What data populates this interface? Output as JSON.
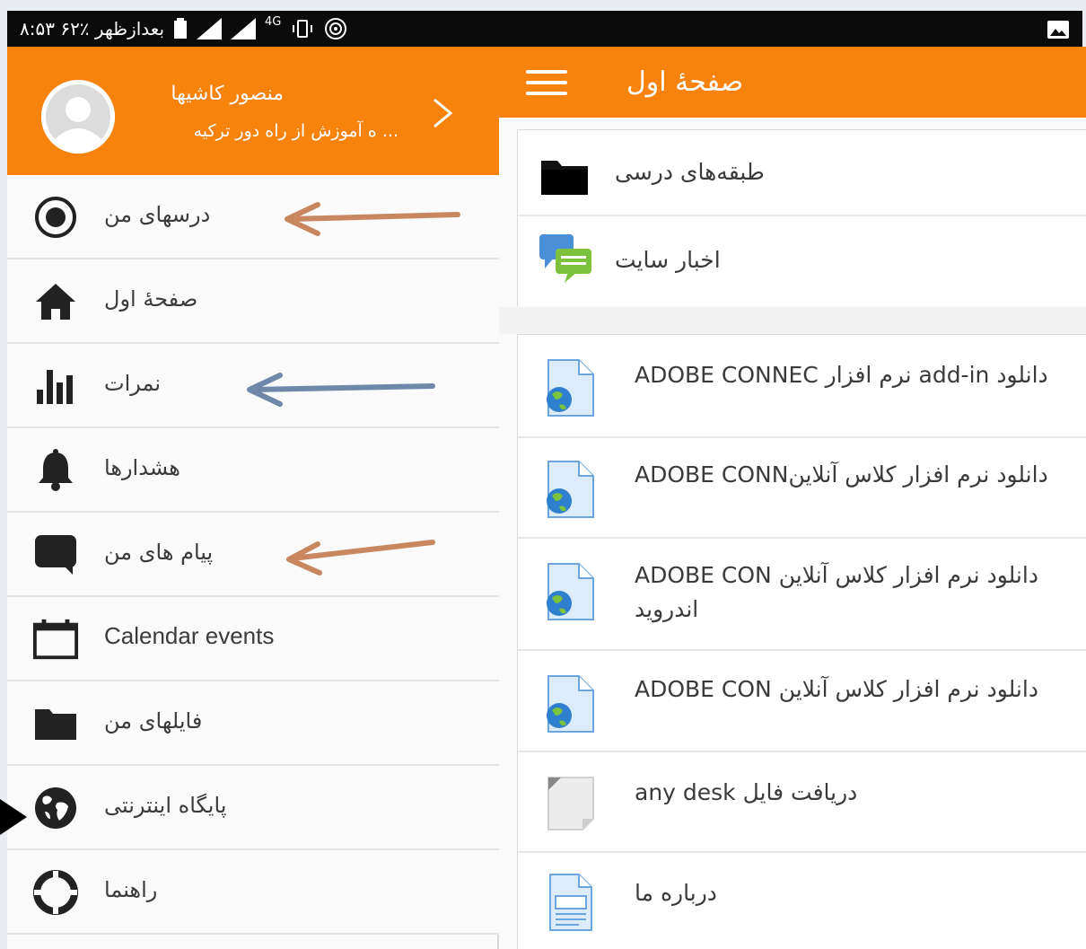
{
  "status_bar": {
    "text": "۸:۵۳ ۶۲٪ بعدازظهر",
    "network": "4G",
    "icons": [
      "gallery-icon",
      "hotspot-icon",
      "vibrate-icon",
      "signal-icon",
      "signal-icon-2",
      "battery-icon"
    ]
  },
  "drawer": {
    "user_name": "منصور کاشیها",
    "org": "... ه آموزش از راه دور ترکیه",
    "items": [
      {
        "label": "درسهای من",
        "icon": "record-icon"
      },
      {
        "label": "صفحهٔ اول",
        "icon": "home-icon"
      },
      {
        "label": "نمرات",
        "icon": "bar-chart-icon"
      },
      {
        "label": "هشدارها",
        "icon": "bell-icon"
      },
      {
        "label": "پیام های من",
        "icon": "chat-bubble-icon"
      },
      {
        "label": "Calendar events",
        "icon": "calendar-icon"
      },
      {
        "label": "فایلهای من",
        "icon": "folder-icon"
      },
      {
        "label": "پایگاه اینترنتی",
        "icon": "globe-icon"
      },
      {
        "label": "راهنما",
        "icon": "lifebuoy-icon"
      }
    ]
  },
  "main": {
    "title": "صفحهٔ اول",
    "top_items": [
      {
        "label": "طبقه‌های درسی",
        "icon": "folder-icon"
      },
      {
        "label": "اخبار سایت",
        "icon": "forum-icon"
      }
    ],
    "content_items": [
      {
        "label": "دانلود add-in نرم افزار ADOBE CONNEC",
        "icon": "web-file-icon"
      },
      {
        "label": "دانلود نرم افزار کلاس آنلاینADOBE CONN",
        "icon": "web-file-icon"
      },
      {
        "label": "دانلود نرم افزار کلاس آنلاین ADOBE CON",
        "label2": "اندروید",
        "icon": "web-file-icon"
      },
      {
        "label": "دانلود نرم افزار کلاس آنلاین ADOBE CON",
        "icon": "web-file-icon"
      },
      {
        "label": "دریافت فایل any desk",
        "icon": "file-icon"
      },
      {
        "label": "درباره ما",
        "icon": "page-icon"
      }
    ]
  },
  "colors": {
    "accent": "#f7830c",
    "arrow_tan": "#c8875e",
    "arrow_blue": "#6f87a8"
  }
}
